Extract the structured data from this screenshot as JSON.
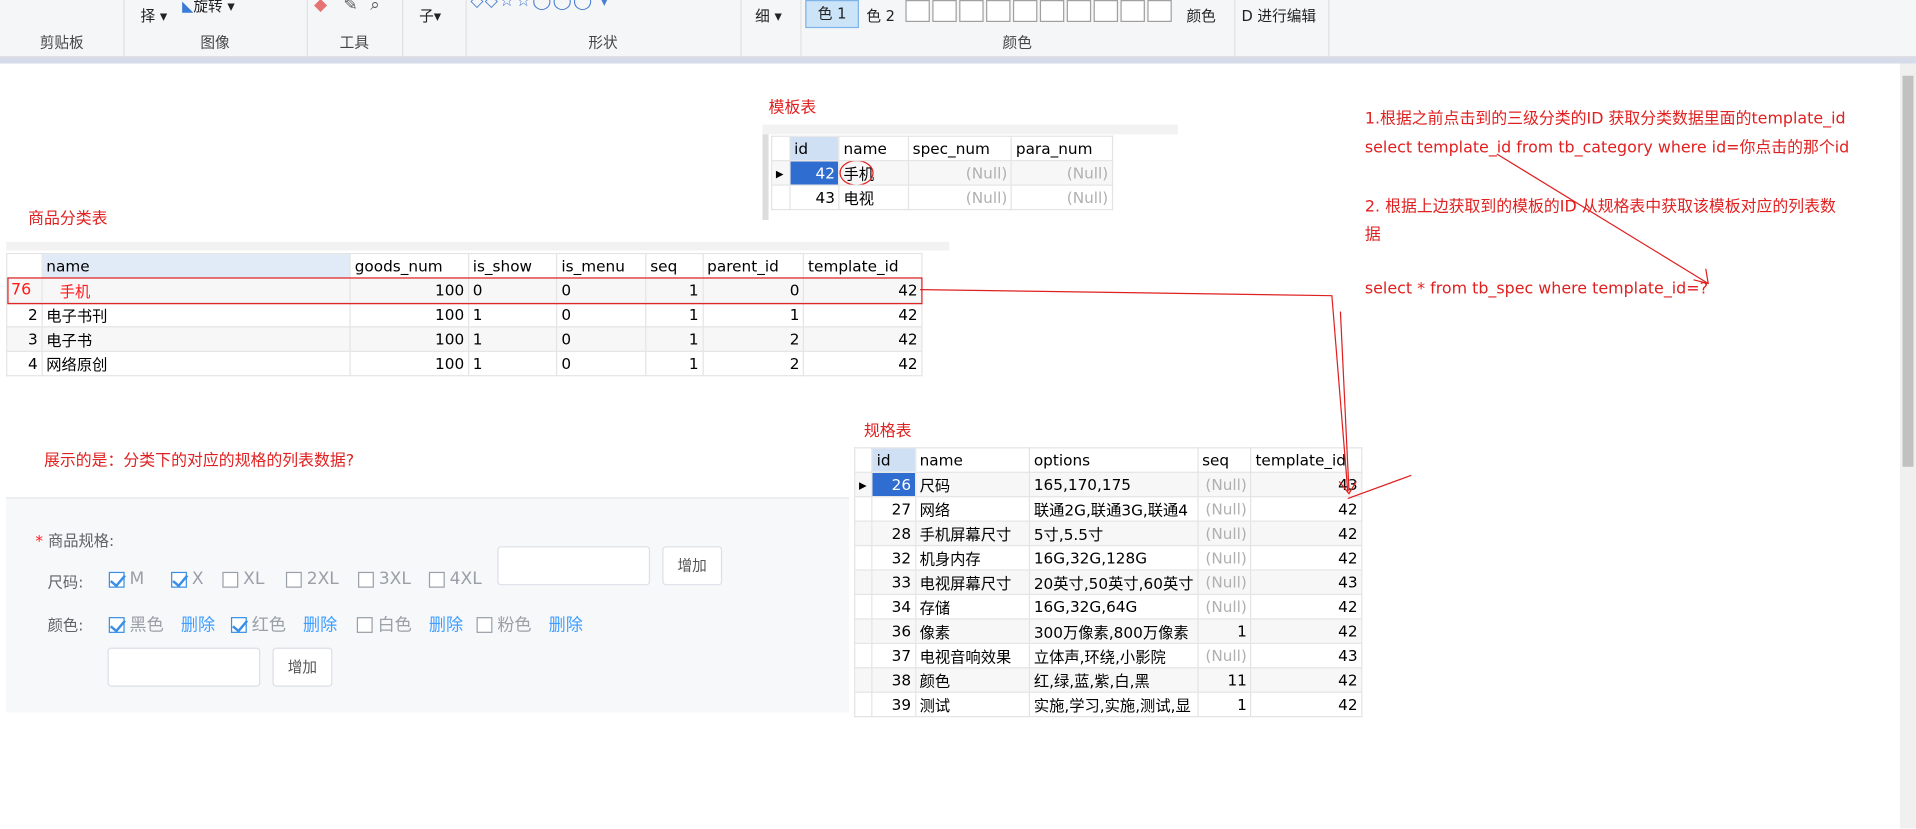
{
  "ribbon": {
    "groups": {
      "clipboard": "剪贴板",
      "image": "图像",
      "tools": "工具",
      "shapes": "形状",
      "colors": "颜色"
    },
    "select_label": "择",
    "rotate_label": "旋转",
    "brush_label": "子",
    "size_label": "细",
    "color1_label": "色 1",
    "color2_label": "色 2",
    "edit_colors_label": "颜色",
    "edit3d_label": "D 进行编辑"
  },
  "template_table": {
    "caption": "模板表",
    "columns": [
      "id",
      "name",
      "spec_num",
      "para_num"
    ],
    "rows": [
      {
        "id": "42",
        "name": "手机",
        "spec_num": "(Null)",
        "para_num": "(Null)"
      },
      {
        "id": "43",
        "name": "电视",
        "spec_num": "(Null)",
        "para_num": "(Null)"
      }
    ]
  },
  "category_table": {
    "caption": "商品分类表",
    "columns": [
      "name",
      "goods_num",
      "is_show",
      "is_menu",
      "seq",
      "parent_id",
      "template_id"
    ],
    "rows": [
      {
        "id": "76",
        "name": "手机",
        "goods_num": "100",
        "is_show": "0",
        "is_menu": "0",
        "seq": "1",
        "parent_id": "0",
        "template_id": "42"
      },
      {
        "id": "2",
        "name": "电子书刊",
        "goods_num": "100",
        "is_show": "1",
        "is_menu": "0",
        "seq": "1",
        "parent_id": "1",
        "template_id": "42"
      },
      {
        "id": "3",
        "name": "电子书",
        "goods_num": "100",
        "is_show": "1",
        "is_menu": "0",
        "seq": "1",
        "parent_id": "2",
        "template_id": "42"
      },
      {
        "id": "4",
        "name": "网络原创",
        "goods_num": "100",
        "is_show": "1",
        "is_menu": "0",
        "seq": "1",
        "parent_id": "2",
        "template_id": "42"
      }
    ]
  },
  "spec_table": {
    "caption": "规格表",
    "columns": [
      "id",
      "name",
      "options",
      "seq",
      "template_id"
    ],
    "rows": [
      {
        "id": "26",
        "name": "尺码",
        "options": "165,170,175",
        "seq": "(Null)",
        "template_id": "43"
      },
      {
        "id": "27",
        "name": "网络",
        "options": "联通2G,联通3G,联通4",
        "seq": "(Null)",
        "template_id": "42"
      },
      {
        "id": "28",
        "name": "手机屏幕尺寸",
        "options": "5寸,5.5寸",
        "seq": "(Null)",
        "template_id": "42"
      },
      {
        "id": "32",
        "name": "机身内存",
        "options": "16G,32G,128G",
        "seq": "(Null)",
        "template_id": "42"
      },
      {
        "id": "33",
        "name": "电视屏幕尺寸",
        "options": "20英寸,50英寸,60英寸",
        "seq": "(Null)",
        "template_id": "43"
      },
      {
        "id": "34",
        "name": "存储",
        "options": "16G,32G,64G",
        "seq": "(Null)",
        "template_id": "42"
      },
      {
        "id": "36",
        "name": "像素",
        "options": "300万像素,800万像素",
        "seq": "1",
        "template_id": "42"
      },
      {
        "id": "37",
        "name": "电视音响效果",
        "options": "立体声,环绕,小影院",
        "seq": "(Null)",
        "template_id": "43"
      },
      {
        "id": "38",
        "name": "颜色",
        "options": "红,绿,蓝,紫,白,黑",
        "seq": "11",
        "template_id": "42"
      },
      {
        "id": "39",
        "name": "测试",
        "options": "实施,学习,实施,测试,显",
        "seq": "1",
        "template_id": "42"
      }
    ]
  },
  "annotations": {
    "step1": "1.根据之前点击到的三级分类的ID 获取分类数据里面的template_id",
    "sql1": "select template_id from tb_category where id=你点击的那个id",
    "step2_line1": "2. 根据上边获取到的模板的ID 从规格表中获取该模板对应的列表数",
    "step2_line2": "据",
    "sql2": "select * from tb_spec where template_id=?",
    "question": "展示的是：分类下的对应的规格的列表数据?"
  },
  "spec_form": {
    "title": "商品规格:",
    "required_mark": "*",
    "size_label": "尺码:",
    "size_options": [
      {
        "label": "M",
        "checked": true
      },
      {
        "label": "X",
        "checked": true
      },
      {
        "label": "XL",
        "checked": false
      },
      {
        "label": "2XL",
        "checked": false
      },
      {
        "label": "3XL",
        "checked": false
      },
      {
        "label": "4XL",
        "checked": false
      }
    ],
    "size_add_button": "增加",
    "color_label": "颜色:",
    "color_options": [
      {
        "label": "黑色",
        "checked": true,
        "delete": "删除"
      },
      {
        "label": "红色",
        "checked": true,
        "delete": "删除"
      },
      {
        "label": "白色",
        "checked": false,
        "delete": "删除"
      },
      {
        "label": "粉色",
        "checked": false,
        "delete": "删除"
      }
    ],
    "color_add_button": "增加"
  },
  "colors": {
    "accent_red": "#e02020",
    "link_blue": "#409eff",
    "selected_row": "#2f6dd0"
  }
}
